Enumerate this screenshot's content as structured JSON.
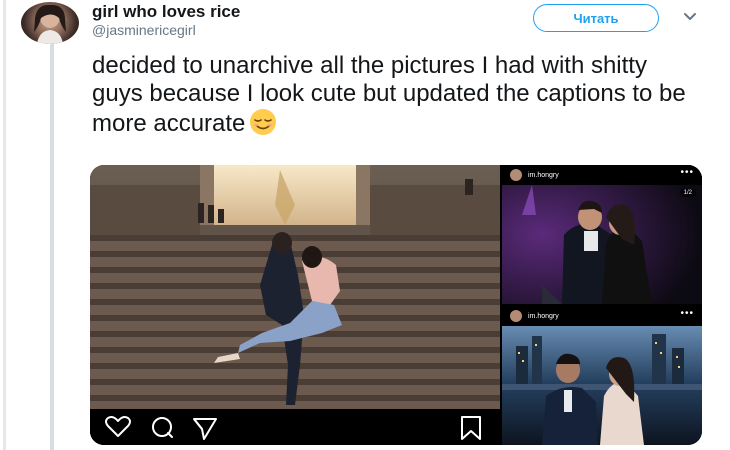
{
  "author": {
    "display_name": "girl who loves rice",
    "handle": "@jasminericegirl"
  },
  "header": {
    "follow_label": "Читать",
    "caret_icon": "chevron-down-icon"
  },
  "tweet": {
    "text": "decided to unarchive all the pictures I had with shitty guys because I look cute but updated the captions to be more accurate",
    "emoji": "relieved-face-emoji"
  },
  "media": {
    "photo_2_username": "im.hongry",
    "photo_2_counter": "1/2",
    "photo_3_username": "im.hongry",
    "photo_3_dots": "•••",
    "photo_2_dots": "•••"
  },
  "colors": {
    "accent": "#1da1f2",
    "text": "#14171a",
    "muted": "#657786"
  }
}
